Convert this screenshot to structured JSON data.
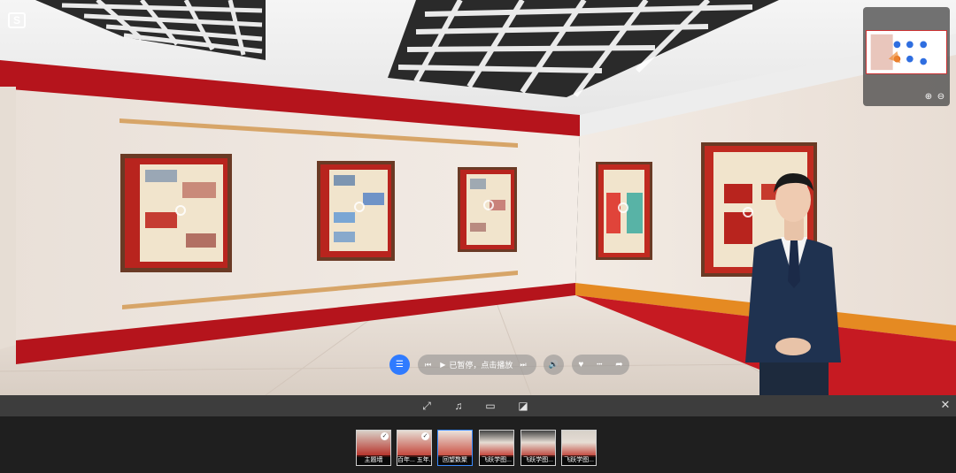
{
  "viewer": {
    "corner_label": "S",
    "minimap": {
      "zoom_in": "⊕",
      "zoom_out": "⊖"
    }
  },
  "player": {
    "status_text": "已暂停，点击播放",
    "prev_glyph": "⏮",
    "play_glyph": "▶",
    "next_glyph": "⏭",
    "list_glyph": "☰",
    "sound_glyph": "🔊",
    "like_glyph": "♥",
    "comment_glyph": "•••",
    "share_glyph": "➦"
  },
  "toolbar": {
    "tools": [
      {
        "name": "fullscreen-icon",
        "glyph": "⤢"
      },
      {
        "name": "music-icon",
        "glyph": "♫"
      },
      {
        "name": "vr-icon",
        "glyph": "▭"
      },
      {
        "name": "gyro-icon",
        "glyph": "◪"
      }
    ],
    "close_glyph": "✕"
  },
  "scenes": [
    {
      "label": "主题墙",
      "checked": true,
      "active": false
    },
    {
      "label": "百年... 五年...",
      "checked": true,
      "active": false
    },
    {
      "label": "回望数聚",
      "checked": false,
      "active": true
    },
    {
      "label": "飞跃学图...",
      "checked": false,
      "active": false
    },
    {
      "label": "飞跃学图...",
      "checked": false,
      "active": false
    },
    {
      "label": "飞跃学图...",
      "checked": false,
      "active": false
    }
  ],
  "colors": {
    "accent_red": "#b5141c",
    "active_blue": "#3c8cff",
    "wall": "#efe6df",
    "floor": "#e3d8cf"
  }
}
